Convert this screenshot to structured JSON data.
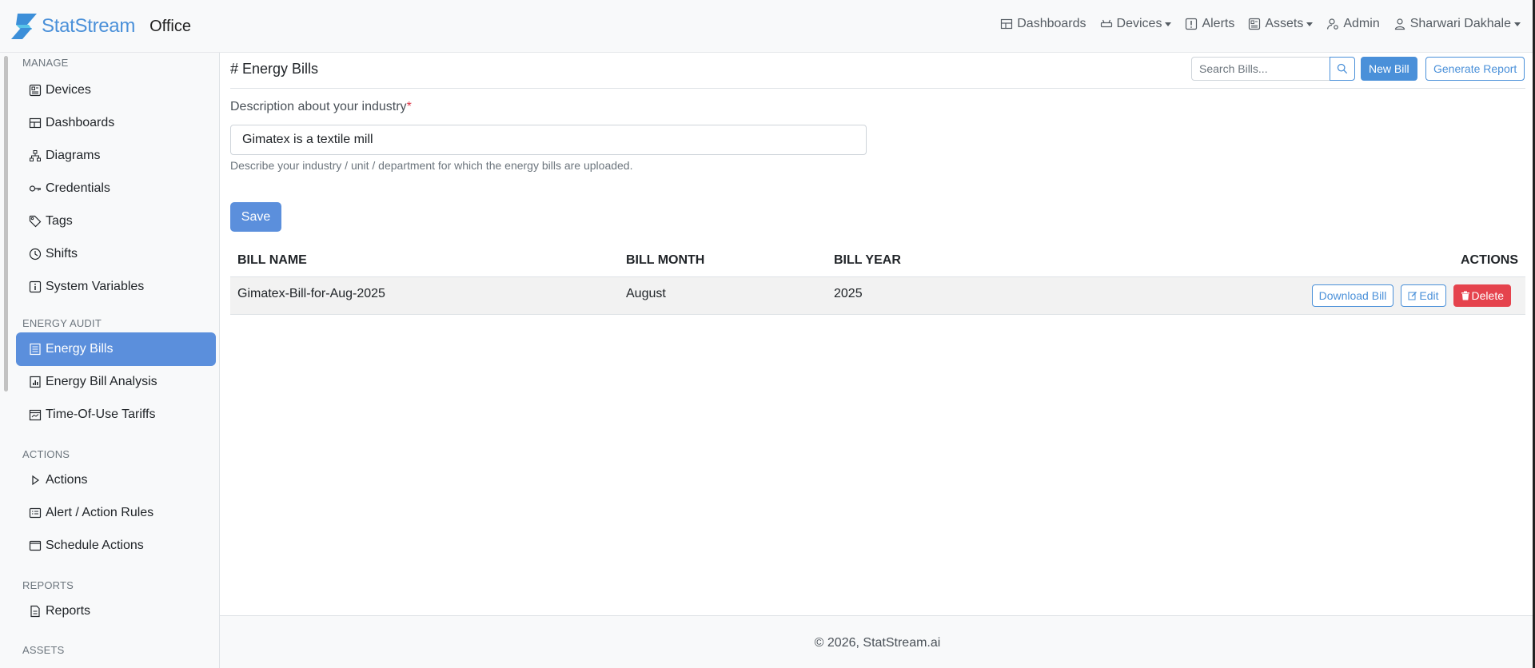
{
  "brand": {
    "name": "StatStream",
    "sub": "Office"
  },
  "topnav": [
    {
      "label": "Dashboards",
      "icon": "dashboard-icon",
      "dropdown": false
    },
    {
      "label": "Devices",
      "icon": "devices-icon",
      "dropdown": true
    },
    {
      "label": "Alerts",
      "icon": "alert-icon",
      "dropdown": false
    },
    {
      "label": "Assets",
      "icon": "assets-icon",
      "dropdown": true
    },
    {
      "label": "Admin",
      "icon": "admin-icon",
      "dropdown": false
    },
    {
      "label": "Sharwari Dakhale",
      "icon": "user-icon",
      "dropdown": true
    }
  ],
  "sidebar": {
    "sections": {
      "manage": "MANAGE",
      "energy_audit": "ENERGY AUDIT",
      "actions": "ACTIONS",
      "reports": "REPORTS",
      "assets": "ASSETS"
    },
    "items": {
      "devices": "Devices",
      "dashboards": "Dashboards",
      "diagrams": "Diagrams",
      "credentials": "Credentials",
      "tags": "Tags",
      "shifts": "Shifts",
      "system_variables": "System Variables",
      "energy_bills": "Energy Bills",
      "energy_bill_analysis": "Energy Bill Analysis",
      "tou_tariffs": "Time-Of-Use Tariffs",
      "actions": "Actions",
      "alert_rules": "Alert / Action Rules",
      "schedule_actions": "Schedule Actions",
      "reports": "Reports"
    },
    "active": "energy_bills"
  },
  "page": {
    "title": "# Energy Bills",
    "search_placeholder": "Search Bills...",
    "new_bill_label": "New Bill",
    "generate_report_label": "Generate Report",
    "field_label": "Description about your industry",
    "required_mark": "*",
    "description_value": "Gimatex is a textile mill",
    "help_text": "Describe your industry / unit / department for which the energy bills are uploaded.",
    "save_label": "Save"
  },
  "table": {
    "columns": [
      "BILL NAME",
      "BILL MONTH",
      "BILL YEAR",
      "ACTIONS"
    ],
    "rows": [
      {
        "name": "Gimatex-Bill-for-Aug-2025",
        "month": "August",
        "year": "2025"
      }
    ],
    "download_label": "Download Bill",
    "edit_label": "Edit",
    "delete_label": "Delete"
  },
  "footer": {
    "text": "© 2026, StatStream.ai"
  },
  "colors": {
    "primary": "#4a90d9",
    "active_nav": "#5b8fdc",
    "danger": "#e5434d"
  }
}
